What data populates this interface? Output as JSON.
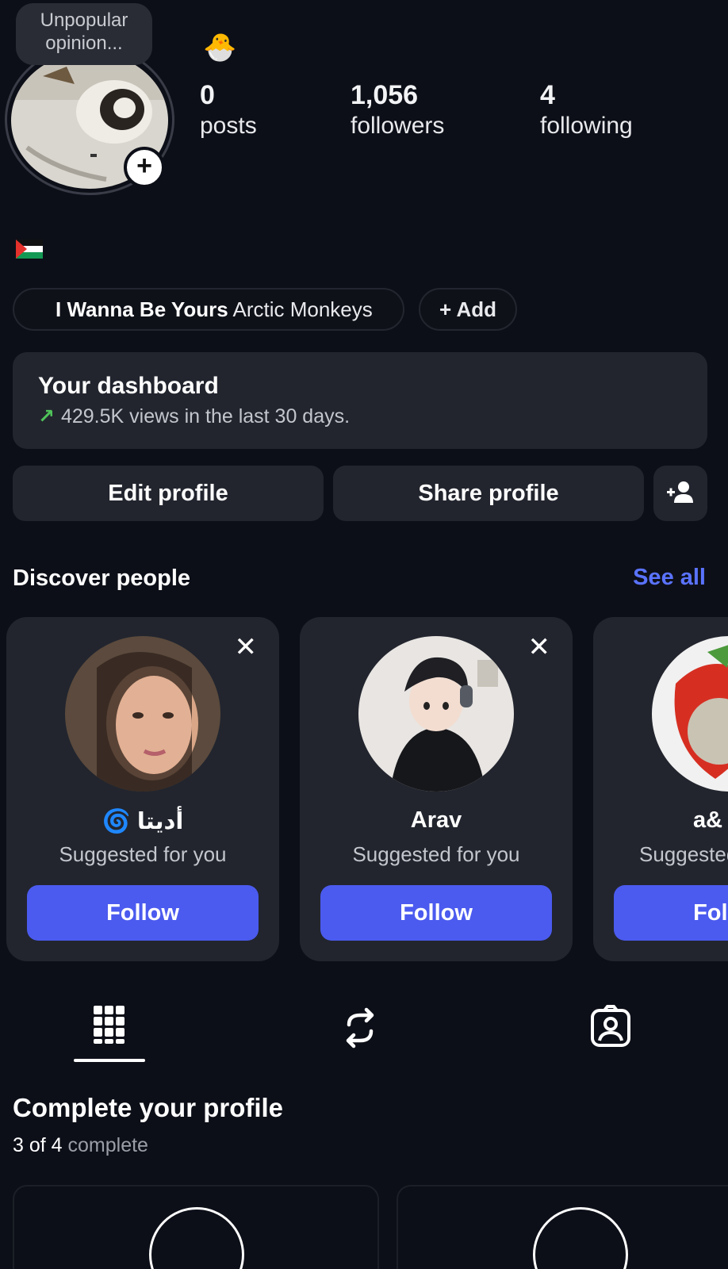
{
  "profile": {
    "note": "Unpopular opinion...",
    "emoji": "🐣",
    "stats": [
      {
        "value": "0",
        "label": "posts"
      },
      {
        "value": "1,056",
        "label": "followers"
      },
      {
        "value": "4",
        "label": "following"
      }
    ]
  },
  "music": {
    "song": "I Wanna Be Yours",
    "artist": "Arctic Monkeys",
    "add_label": "+ Add"
  },
  "dashboard": {
    "title": "Your dashboard",
    "subtitle": "429.5K views in the last 30 days."
  },
  "actions": {
    "edit": "Edit profile",
    "share": "Share profile"
  },
  "discover": {
    "title": "Discover people",
    "see_all": "See all",
    "cards": [
      {
        "name": "🌀 أديتا",
        "subtitle": "Suggested for you",
        "button": "Follow"
      },
      {
        "name": "Arav",
        "subtitle": "Suggested for you",
        "button": "Follow"
      },
      {
        "name": "a&",
        "subtitle": "Suggested for you",
        "button": "Follow"
      }
    ]
  },
  "complete_profile": {
    "title": "Complete your profile",
    "progress": "3 of 4",
    "progress_suffix": " complete"
  },
  "colors": {
    "background": "#0d0f18",
    "surface": "#22252e",
    "accent": "#4b5bef",
    "link": "#5a73ff",
    "trend": "#4fc25a"
  }
}
